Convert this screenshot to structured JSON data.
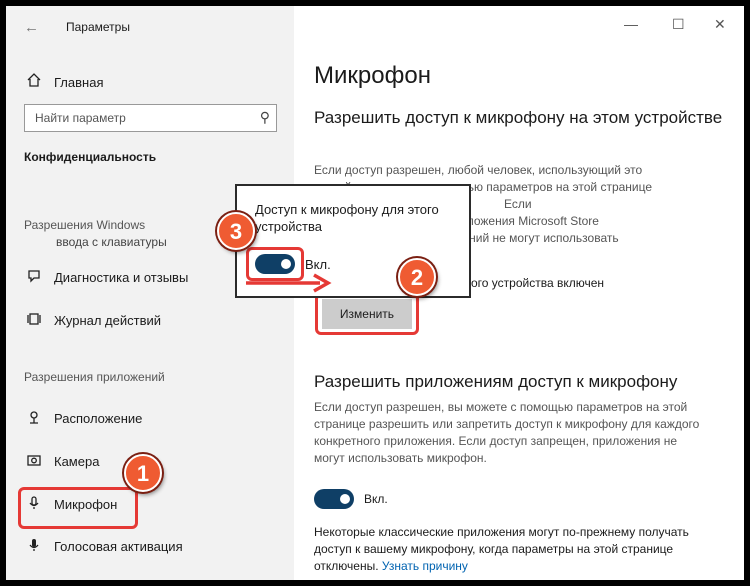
{
  "app": {
    "title": "Параметры",
    "back_icon": "back-arrow-icon"
  },
  "sidebar": {
    "home_label": "Главная",
    "search_placeholder": "Найти параметр",
    "section_title": "Конфиденциальность",
    "group_windows": "Разрешения Windows",
    "partial_item": "ввода с клавиатуры",
    "windows_items": [
      {
        "label": "Диагностика и отзывы",
        "icon": "feedback-icon"
      },
      {
        "label": "Журнал действий",
        "icon": "activity-history-icon"
      }
    ],
    "group_apps": "Разрешения приложений",
    "app_items": [
      {
        "label": "Расположение",
        "icon": "location-icon"
      },
      {
        "label": "Камера",
        "icon": "camera-icon"
      },
      {
        "label": "Микрофон",
        "icon": "microphone-icon"
      },
      {
        "label": "Голосовая активация",
        "icon": "voice-activation-icon"
      }
    ]
  },
  "window_controls": {
    "minimize": "—",
    "maximize": "☐",
    "close": "✕"
  },
  "main": {
    "title": "Микрофон",
    "device_heading": "Разрешить доступ к микрофону на этом устройстве",
    "device_para": "Если доступ разрешен, любой человек, использующий это устройство, может с помощью параметров на этой странице выбрать... Если доступ запрещен, компоненты Windows, приложения Microsoft Store и большинство классических приложений не могут использовать микрофон.",
    "device_para_lines": [
      "Если доступ разрешен, любой человек, использующий это",
      "устройство, может с помощью параметров на этой странице",
      "                                                         Если",
      "                  ты Windows, приложения Microsoft Store",
      "                  ических приложений не могут использовать"
    ],
    "device_status": "ого устройства включен",
    "change_button": "Изменить",
    "apps_heading": "Разрешить приложениям доступ к микрофону",
    "apps_para_lines": [
      "Если доступ разрешен, вы можете с помощью параметров на этой",
      "странице разрешить или запретить доступ к микрофону для каждого",
      "конкретного приложения. Если доступ запрещен, приложения не",
      "могут использовать микрофон."
    ],
    "apps_toggle_label": "Вкл.",
    "apps_toggle_state": "on",
    "classic_para_lines": [
      "Некоторые классические приложения могут по-прежнему получать",
      "доступ к вашему микрофону, когда параметры на этой странице",
      "отключены."
    ],
    "learn_more_link": "Узнать причину"
  },
  "popup": {
    "text": "Доступ к микрофону для этого устройства",
    "toggle_label": "Вкл.",
    "toggle_state": "on"
  },
  "annotations": {
    "badge_1": "1",
    "badge_2": "2",
    "badge_3": "3",
    "highlight_color": "#e53935",
    "badge_color": "#ef5b32"
  }
}
